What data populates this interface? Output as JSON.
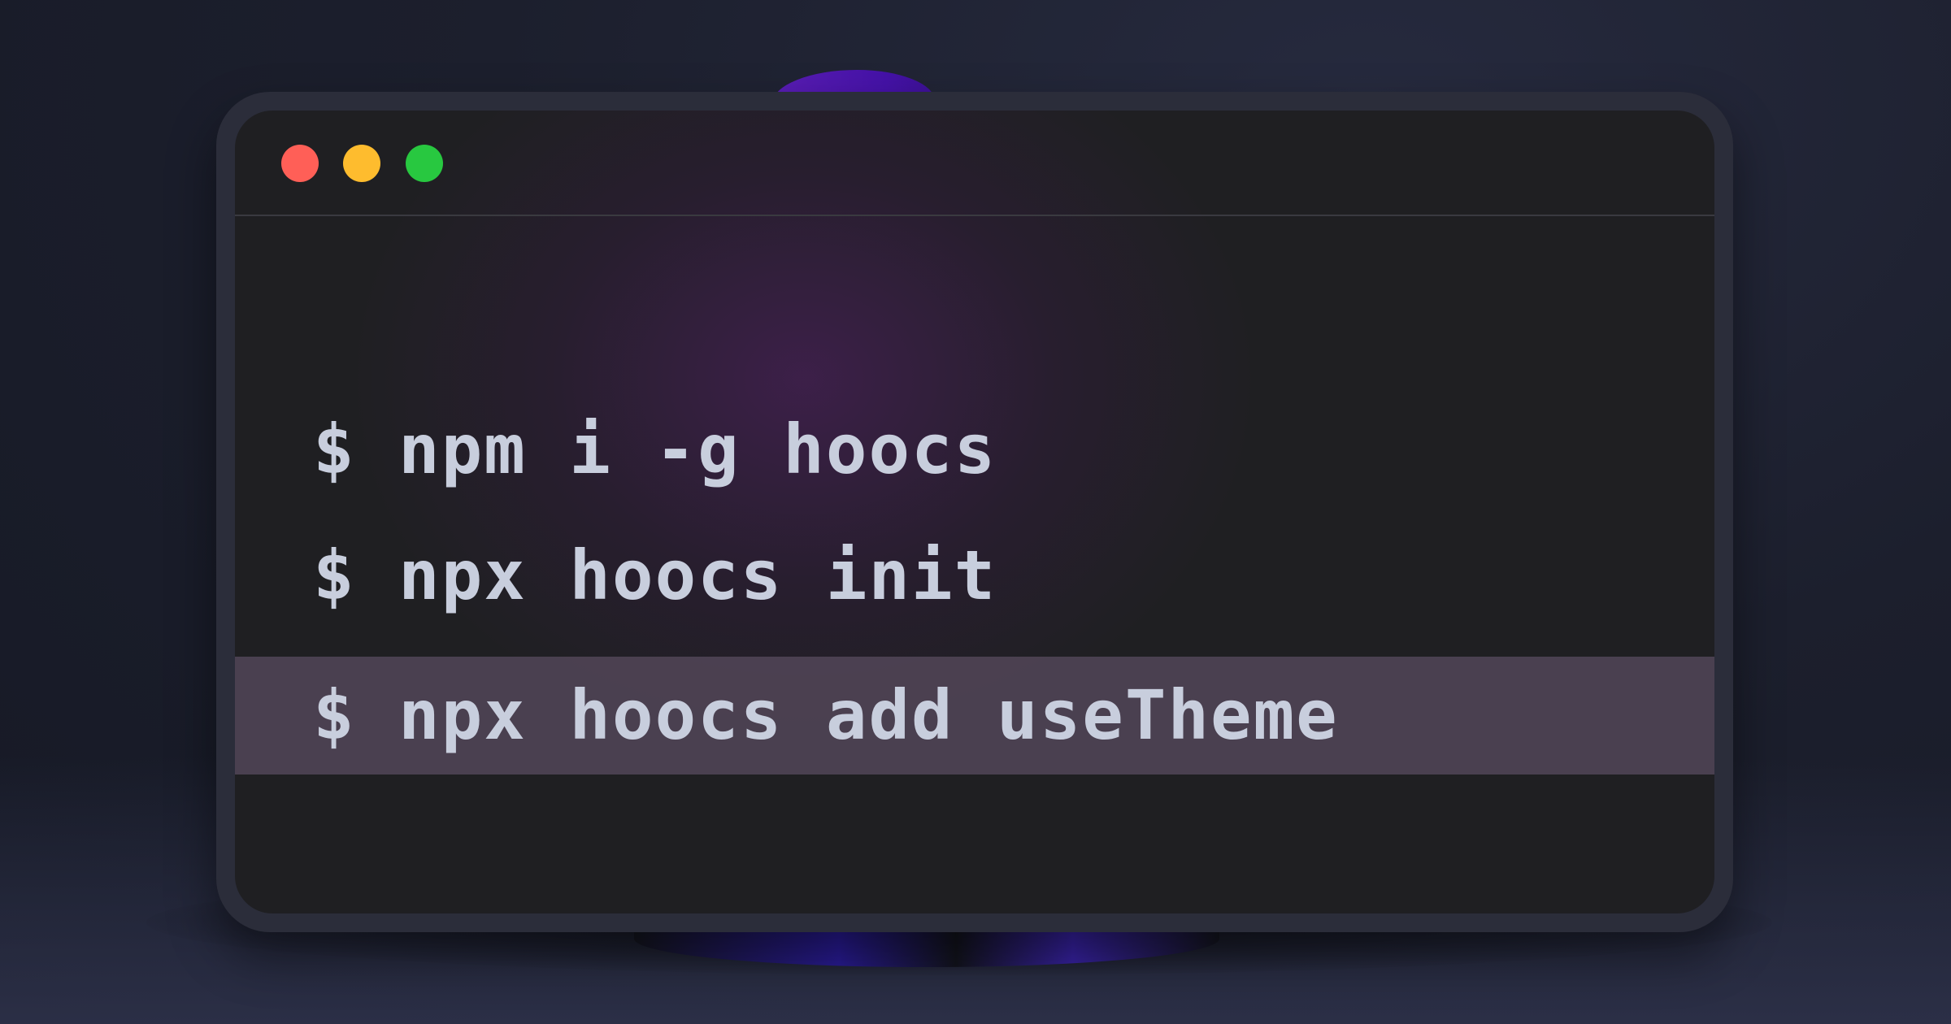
{
  "window": {
    "controls": [
      {
        "name": "close",
        "color": "#ff5f57"
      },
      {
        "name": "minimize",
        "color": "#febc2e"
      },
      {
        "name": "maximize",
        "color": "#28c840"
      }
    ]
  },
  "terminal": {
    "lines": [
      {
        "text": "$ npm i -g hoocs",
        "highlighted": false
      },
      {
        "text": "$ npx hoocs init",
        "highlighted": false
      },
      {
        "text": "$ npx hoocs add useTheme",
        "highlighted": true
      }
    ]
  },
  "colors": {
    "background": "#1c1f2d",
    "window_bg": "#1f1f22",
    "text": "#c8cedd",
    "highlight": "#524658",
    "accent_purple": "#5a1db5"
  }
}
